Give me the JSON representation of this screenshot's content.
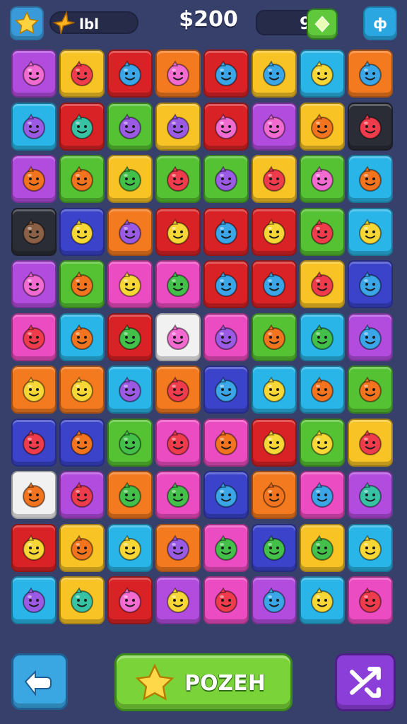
{
  "hud": {
    "level_label": "lbl",
    "score": "$200",
    "moves": "9",
    "menu_label": "ф"
  },
  "play_button": {
    "label": "POZEH"
  },
  "icons": {
    "top_left": "star-icon",
    "level": "lightning-icon",
    "gem": "gem-icon",
    "menu": "menu-icon",
    "back": "hand-pointer-icon",
    "play": "star-icon",
    "shuffle": "shuffle-icon"
  },
  "colors": {
    "background": "#37406b",
    "tile_colors": {
      "pu": "#b24cdf",
      "ye": "#f7c325",
      "rd": "#d92225",
      "or": "#f47a1f",
      "cy": "#29b5e8",
      "gr": "#55c233",
      "pk": "#ec4cc2",
      "bk": "#2a2d36",
      "wh": "#f1f1f1",
      "nv": "#3a43c9"
    },
    "face_colors": {
      "pink": "#f16bd1",
      "red": "#ef3c4d",
      "blue": "#3aa6e8",
      "orange": "#f3741f",
      "yellow": "#f7d735",
      "green": "#43c04a",
      "purple": "#9a5ae4",
      "brown": "#8a6046",
      "teal": "#37c2a3"
    }
  },
  "board": {
    "rows": [
      [
        "pu:pink",
        "ye:red",
        "rd:blue",
        "or:pink",
        "rd:blue",
        "ye:blue",
        "cy:yellow",
        "or:blue"
      ],
      [
        "cy:purple",
        "rd:teal",
        "gr:purple",
        "ye:purple",
        "rd:pink",
        "pu:pink",
        "ye:orange",
        "bk:red"
      ],
      [
        "pu:orange",
        "gr:orange",
        "ye:green",
        "gr:red",
        "gr:purple",
        "ye:red",
        "gr:pink",
        "cy:orange"
      ],
      [
        "bk:brown",
        "nv:yellow",
        "or:purple",
        "rd:yellow",
        "rd:blue",
        "rd:yellow",
        "gr:red",
        "cy:yellow"
      ],
      [
        "pu:pink",
        "gr:orange",
        "pk:yellow",
        "pk:green",
        "rd:blue",
        "rd:blue",
        "ye:red",
        "nv:blue"
      ],
      [
        "pk:red",
        "cy:orange",
        "rd:green",
        "wh:pink",
        "pk:purple",
        "gr:orange",
        "cy:green",
        "pu:blue"
      ],
      [
        "or:yellow",
        "or:yellow",
        "cy:purple",
        "or:red",
        "nv:blue",
        "cy:yellow",
        "cy:orange",
        "gr:orange"
      ],
      [
        "nv:red",
        "nv:orange",
        "gr:green",
        "pk:red",
        "pk:orange",
        "rd:yellow",
        "gr:yellow",
        "ye:red"
      ],
      [
        "wh:orange",
        "pu:red",
        "or:green",
        "pk:green",
        "nv:blue",
        "or:orange",
        "pk:blue",
        "pu:teal"
      ],
      [
        "rd:yellow",
        "ye:orange",
        "cy:yellow",
        "or:purple",
        "pk:green",
        "nv:green",
        "ye:green",
        "cy:yellow"
      ],
      [
        "cy:purple",
        "ye:teal",
        "rd:pink",
        "pu:yellow",
        "pk:red",
        "pu:blue",
        "cy:yellow",
        "pk:red"
      ]
    ]
  }
}
